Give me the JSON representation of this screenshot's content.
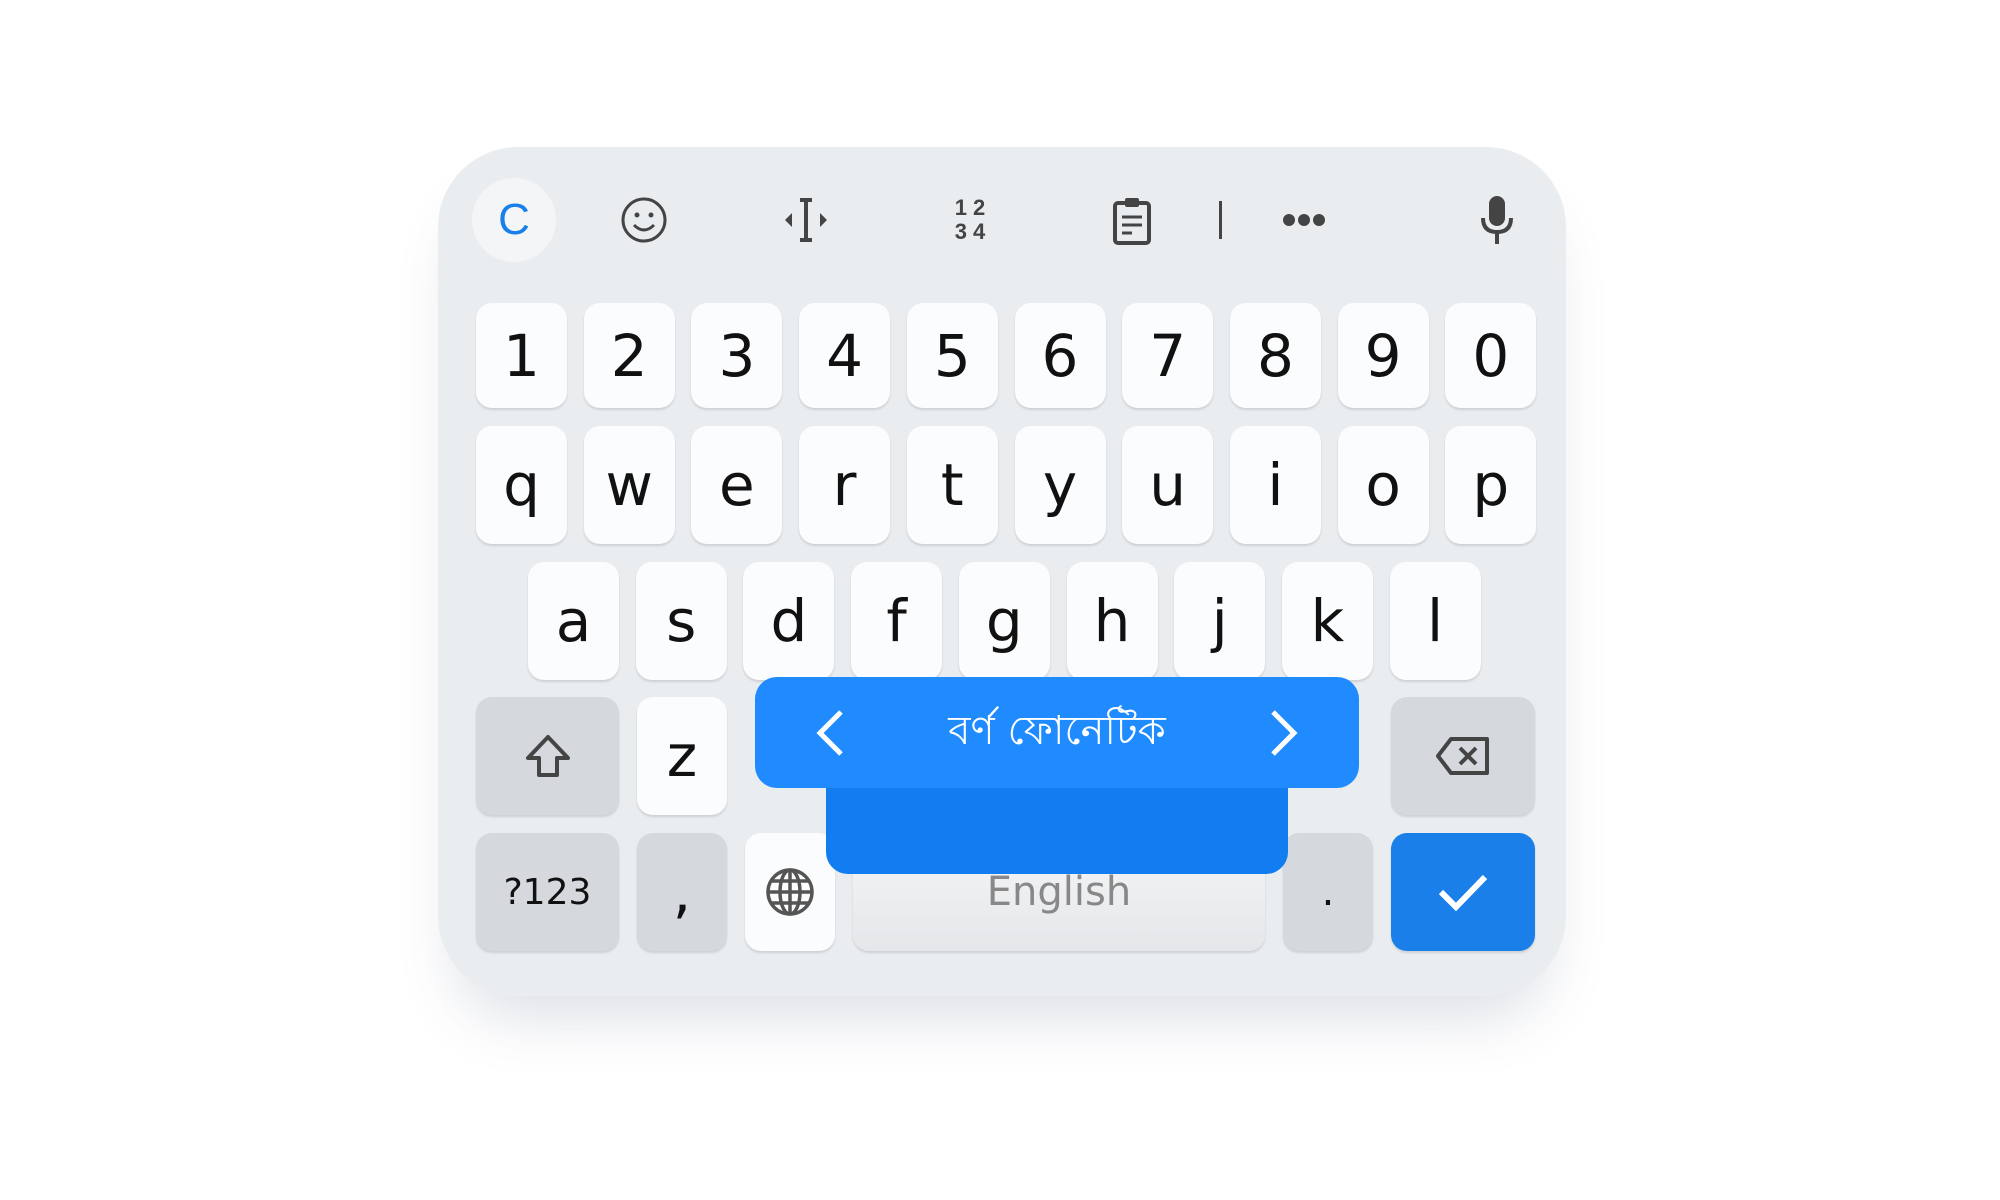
{
  "toolbar": {
    "icons": [
      "c-logo-icon",
      "emoji-icon",
      "cursor-move-icon",
      "numpad-icon",
      "clipboard-icon",
      "more-icon",
      "mic-icon"
    ],
    "c_label": "C",
    "numpad_label": "1 2 3 4"
  },
  "rows": {
    "numbers": [
      "1",
      "2",
      "3",
      "4",
      "5",
      "6",
      "7",
      "8",
      "9",
      "0"
    ],
    "row1": [
      "q",
      "w",
      "e",
      "r",
      "t",
      "y",
      "u",
      "i",
      "o",
      "p"
    ],
    "row2": [
      "a",
      "s",
      "d",
      "f",
      "g",
      "h",
      "j",
      "k",
      "l"
    ],
    "z": "z"
  },
  "bottom": {
    "symbols": "?123",
    "comma": ",",
    "space": "English",
    "period": "."
  },
  "language_popup": {
    "label": "বর্ণ ফোনেটিক"
  },
  "colors": {
    "accent": "#1f8bff",
    "enter": "#1a7fe8",
    "background": "#eaedf0"
  }
}
